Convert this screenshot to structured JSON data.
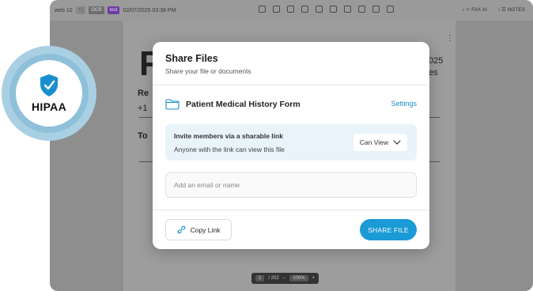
{
  "toolbar": {
    "doc_name": "web 10",
    "count": "+1",
    "ocr_tag": "OCR",
    "test_tag": "test",
    "timestamp": "02/07/2025 03:38 PM",
    "fax_ai_label": "FAX AI",
    "notes_label": "NOTES"
  },
  "document": {
    "big_letter": "F",
    "year_fragment": "025",
    "es_fragment": "es",
    "re_fragment": "Re",
    "plus_fragment": "+1",
    "to_fragment": "To"
  },
  "pager": {
    "current_page": "1",
    "total_pages": "/ 202",
    "zoom": "100%",
    "minus": "−",
    "plus": "+"
  },
  "badge": {
    "label": "HIPAA",
    "accent": "#1a8fcf"
  },
  "modal": {
    "title": "Share Files",
    "subtitle": "Share your file or documents",
    "file_name": "Patient Medical History Form",
    "settings_label": "Settings",
    "invite_title": "Invite members via a sharable link",
    "invite_desc": "Anyone with the link can view this file",
    "permission": "Can View",
    "email_placeholder": "Add an email or name",
    "copy_link_label": "Copy Link",
    "share_label": "SHARE FILE",
    "accent": "#1a9ad6"
  }
}
